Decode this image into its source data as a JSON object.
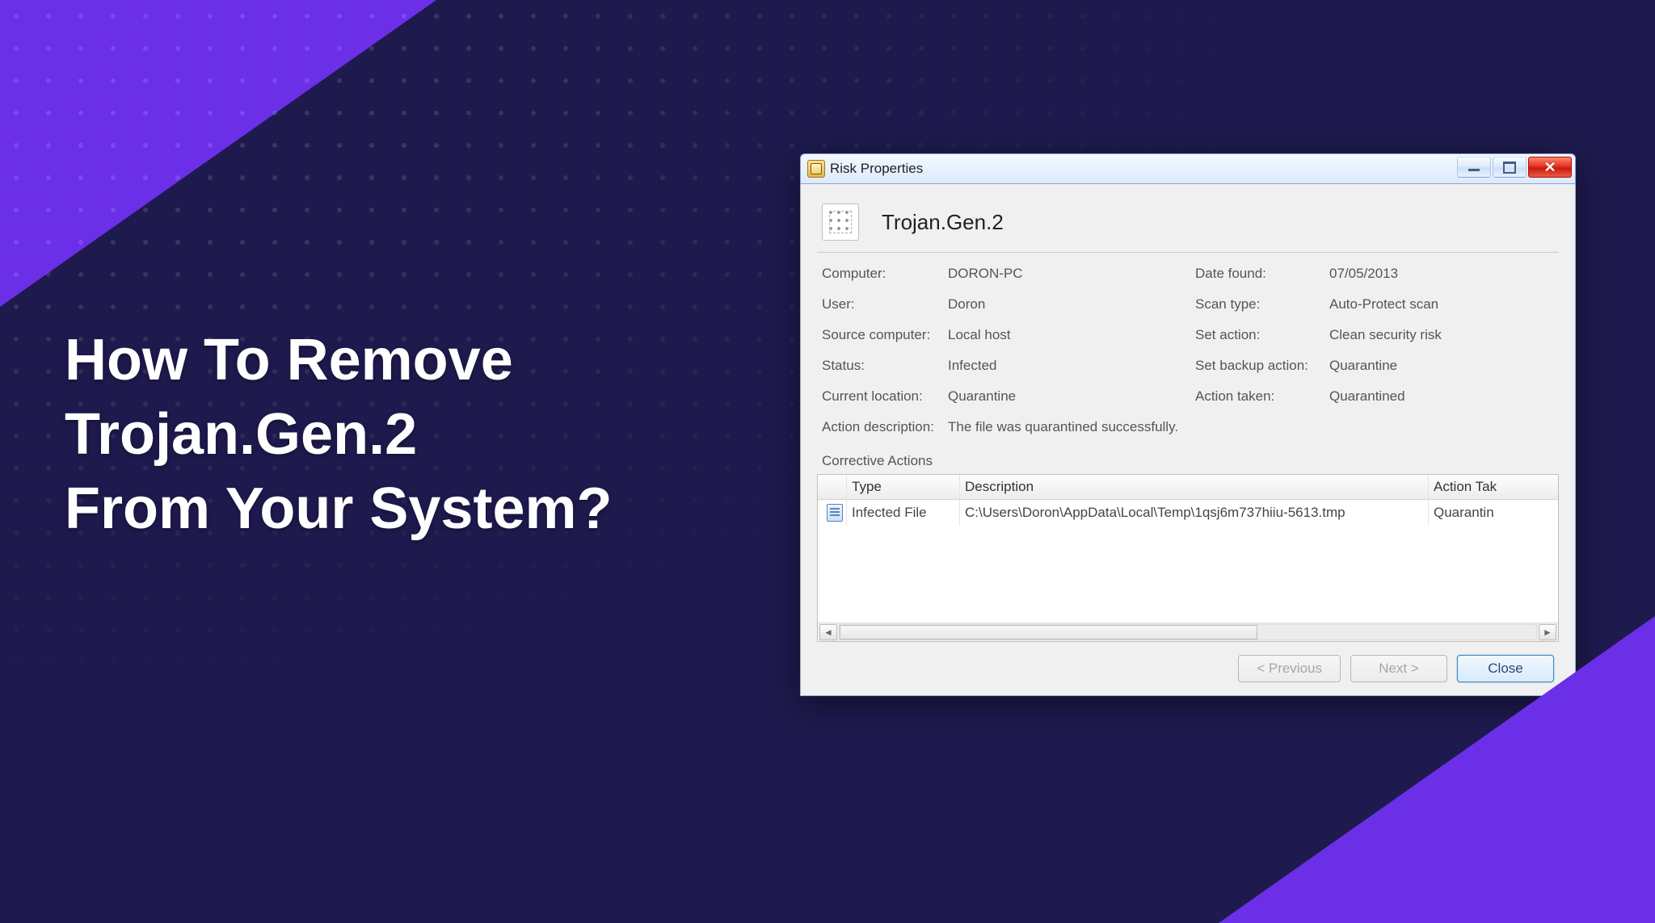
{
  "colors": {
    "bg": "#1e1a4e",
    "accent": "#6b2fe8"
  },
  "headline": {
    "line1": "How To Remove",
    "line2": "Trojan.Gen.2",
    "line3": "From Your System?"
  },
  "window": {
    "title": "Risk Properties",
    "risk_name": "Trojan.Gen.2",
    "details": {
      "computer_label": "Computer:",
      "computer_value": "DORON-PC",
      "user_label": "User:",
      "user_value": "Doron",
      "source_label": "Source computer:",
      "source_value": "Local host",
      "status_label": "Status:",
      "status_value": "Infected",
      "location_label": "Current location:",
      "location_value": "Quarantine",
      "actiondesc_label": "Action description:",
      "actiondesc_value": "The file was quarantined successfully.",
      "datefound_label": "Date found:",
      "datefound_value": "07/05/2013",
      "scantype_label": "Scan type:",
      "scantype_value": "Auto-Protect scan",
      "setaction_label": "Set action:",
      "setaction_value": "Clean security risk",
      "setbackup_label": "Set backup action:",
      "setbackup_value": "Quarantine",
      "actiontaken_label": "Action taken:",
      "actiontaken_value": "Quarantined"
    },
    "section_title": "Corrective Actions",
    "columns": {
      "type": "Type",
      "description": "Description",
      "action_taken": "Action Tak"
    },
    "rows": [
      {
        "type": "Infected File",
        "description": "C:\\Users\\Doron\\AppData\\Local\\Temp\\1qsj6m737hiiu-5613.tmp",
        "action": "Quarantin"
      }
    ],
    "buttons": {
      "prev": "< Previous",
      "next": "Next >",
      "close": "Close"
    }
  }
}
